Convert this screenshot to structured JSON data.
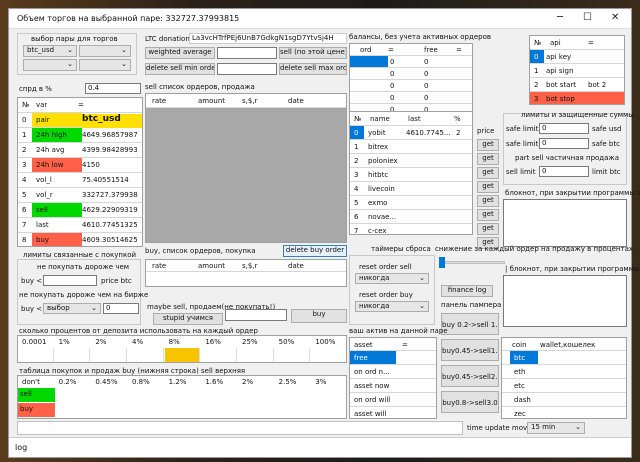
{
  "title": "Объем торгов на выбранной паре: 332727.37993815",
  "window_controls": {
    "min": "─",
    "max": "☐",
    "close": "✕"
  },
  "pair_panel": {
    "header": "выбор пары для торгов",
    "pair": "btc_usd",
    "pair2": "",
    "spread_label": "спрд в %",
    "spread_value": "0.4"
  },
  "market_table": {
    "cols": [
      "№",
      "var",
      "="
    ],
    "rows": [
      {
        "n": "0",
        "k": "pair",
        "v": "btc_usd",
        "color": "#ffe000"
      },
      {
        "n": "1",
        "k": "24h high",
        "v": "4649.96857987",
        "color": "#00d800"
      },
      {
        "n": "2",
        "k": "24h avg",
        "v": "4399.98428993",
        "color": "#ffffff"
      },
      {
        "n": "3",
        "k": "24h low",
        "v": "4150",
        "color": "#ff6048"
      },
      {
        "n": "4",
        "k": "vol_l",
        "v": "75.40551514",
        "color": "#ffffff"
      },
      {
        "n": "5",
        "k": "vol_r",
        "v": "332727.379938",
        "color": "#ffffff"
      },
      {
        "n": "6",
        "k": "sell",
        "v": "4629.22909319",
        "color": "#00d800"
      },
      {
        "n": "7",
        "k": "last",
        "v": "4610.77451325",
        "color": "#ffffff"
      },
      {
        "n": "8",
        "k": "buy",
        "v": "4609.30514625",
        "color": "#ff6048"
      }
    ]
  },
  "donation": {
    "label": "LTC donation",
    "address": "La3vcHTrfPEj6UnB7GdkgN1sgD7YtvSj4H"
  },
  "sell_buttons": {
    "weighted": "weighted average",
    "sell_at_price": "sell (по этой цене)",
    "delete_sell_min": "delete sell min order",
    "delete_sell_max": "delete sell max ord"
  },
  "sell_orders": {
    "title": "sell список ордеров, продажа",
    "cols": [
      "rate",
      "amount",
      "s,$,r",
      "date"
    ]
  },
  "balances": {
    "title": "балансы, без учета активных ордеров",
    "cols": [
      "ord",
      "=",
      "free",
      "="
    ],
    "values": [
      "0",
      "0",
      "0",
      "0",
      "0"
    ]
  },
  "api_table": {
    "cols": [
      "№",
      "api",
      "="
    ],
    "rows": [
      {
        "n": "0",
        "k": "api key",
        "v": ""
      },
      {
        "n": "1",
        "k": "api sign",
        "v": ""
      },
      {
        "n": "2",
        "k": "bot start",
        "v": "bot 2"
      },
      {
        "n": "3",
        "k": "bot stop",
        "v": ""
      }
    ]
  },
  "exchange_table": {
    "cols": [
      "№",
      "name",
      "last",
      "%"
    ],
    "rows": [
      {
        "n": "0",
        "name": "yobit",
        "last": "4610.7745...",
        "p": "2"
      },
      {
        "n": "1",
        "name": "bitrex"
      },
      {
        "n": "2",
        "name": "poloniex"
      },
      {
        "n": "3",
        "name": "hitbtc"
      },
      {
        "n": "4",
        "name": "livecoin"
      },
      {
        "n": "5",
        "name": "exmo"
      },
      {
        "n": "6",
        "name": "novae..."
      },
      {
        "n": "7",
        "name": "c-cex"
      }
    ],
    "price_label": "price",
    "get": "get"
  },
  "limits": {
    "title": "лимиты и защищенные суммы",
    "safe_usd_label": "safe limit",
    "safe_usd": "0",
    "safe_usd_unit": "safe usd",
    "safe_btc_label": "safe limit",
    "safe_btc": "0",
    "safe_btc_unit": "safe btc",
    "part_sell": "part sell частичная продажа",
    "sell_limit_label": "sell limit",
    "sell_limit": "0",
    "sell_limit_unit": "limit btc"
  },
  "notepad1": "блокнот, при закрытии программы ав",
  "buy_limits": {
    "title": "лимиты связанные с покупкой",
    "no_buy_more": "не покупать дороже чем",
    "buy_lt": "buy <",
    "price_btc": "price btc",
    "no_buy_market": "не покупать дороже чем на бирже",
    "buy_lt2": "buy <",
    "choose": "выбор",
    "pct": "0"
  },
  "buy_orders": {
    "title": "buy, список ордеров, покупка",
    "delete_buy": "delete buy order",
    "cols": [
      "rate",
      "amount",
      "s,$,r",
      "date"
    ],
    "maybe_sell": "maybe sell, продаем(не покупать!)",
    "stupid": "stupid учимся",
    "buy_btn": "buy"
  },
  "timers": {
    "title": "таймеры сброса",
    "reset_sell": "reset order sell",
    "never1": "никогда",
    "reset_buy": "reset order buy",
    "never2": "никогда"
  },
  "reduce": {
    "title": "снижение за каждый ордер на продажу в процентах",
    "slider": 0,
    "finance_log": "finance log",
    "pump_panel": "панель пампера",
    "b1": "buy 0.2->sell 1.2",
    "b2": "buy0.45->sell1.6",
    "b3": "buy0.45->sell2.0",
    "b4": "buy0.8->sell3.0"
  },
  "notepad2": "| блокнот, при закрытии программы",
  "deposit": {
    "title": "сколько процентов от депозита использовать на каждый ордер",
    "levels": [
      "0.0001",
      "1%",
      "2%",
      "4%",
      "8%",
      "16%",
      "25%",
      "50%",
      "100%"
    ],
    "selected": 4
  },
  "table_buy_sell": {
    "title": "таблица покупок и продаж buy (нижняя строка) sell верхняя",
    "cols": [
      "don't",
      "0.2%",
      "0.45%",
      "0.8%",
      "1.2%",
      "1.6%",
      "2%",
      "2.5%",
      "3%"
    ],
    "sell": "sell",
    "buy": "buy"
  },
  "assets": {
    "title": "ваш актив на данной паре",
    "cols": [
      "asset",
      "="
    ],
    "rows": [
      "free",
      "on ord n...",
      "asset now",
      "on ord will",
      "asset will"
    ]
  },
  "wallets": {
    "cols": [
      "coin",
      "wallet,кошелек"
    ],
    "rows": [
      "btc",
      "eth",
      "etc",
      "dash",
      "zec"
    ]
  },
  "time_update": {
    "label": "time update move",
    "value": "15 min"
  },
  "log": "log"
}
